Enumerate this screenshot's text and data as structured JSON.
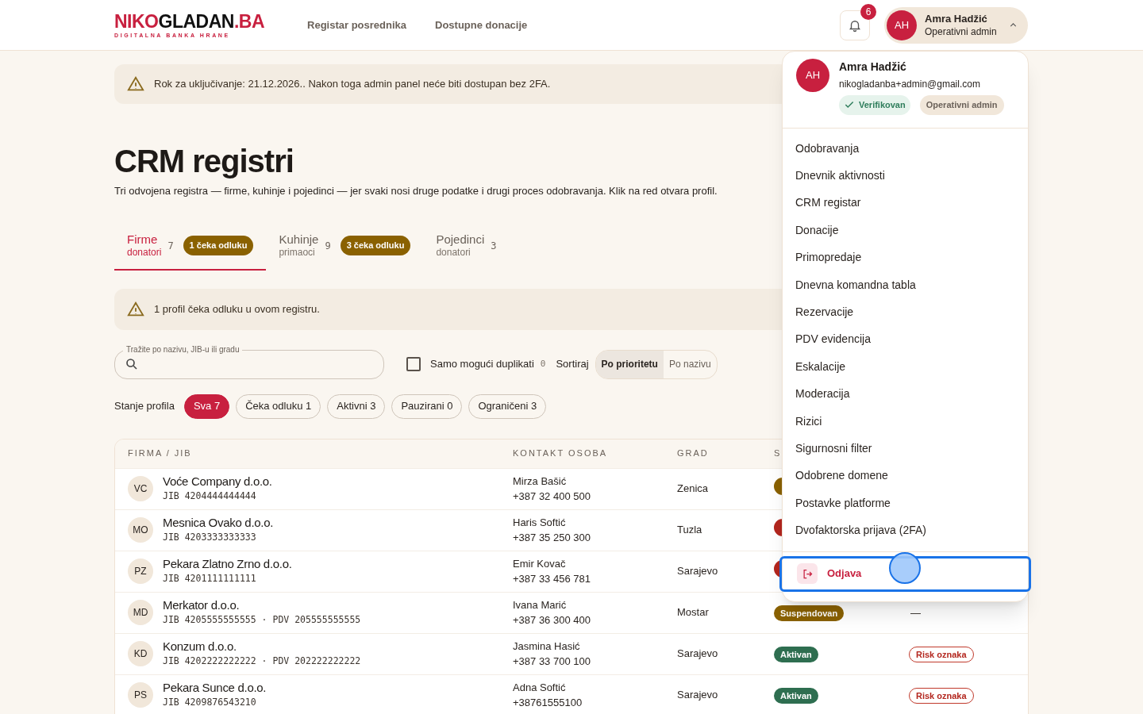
{
  "logo": {
    "parts": [
      {
        "text": "NIKO",
        "accent": true
      },
      {
        "text": "GLADAN",
        "accent": false
      },
      {
        "text": ".BA",
        "accent": true
      }
    ],
    "tagline": "DIGITALNA BANKA HRANE"
  },
  "nav": [
    "Registar posrednika",
    "Dostupne donacije"
  ],
  "notifications": {
    "count": "6"
  },
  "user": {
    "initials": "AH",
    "name": "Amra Hadžić",
    "role": "Operativni admin",
    "expanded": true
  },
  "notice": "Rok za uključivanje: 21.12.2026.. Nakon toga admin panel neće biti dostupan bez 2FA.",
  "title": "CRM registri",
  "subtitle": "Tri odvojena registra — firme, kuhinje i pojedinci — jer svaki nosi druge podatke i drugi proces odobravanja. Klik na red otvara profil.",
  "tabs": [
    {
      "label": "Firme",
      "sub": "donatori",
      "count": "7",
      "badge": "1 čeka odluku",
      "selected": true
    },
    {
      "label": "Kuhinje",
      "sub": "primaoci",
      "count": "9",
      "badge": "3 čeka odluku",
      "selected": false
    },
    {
      "label": "Pojedinci",
      "sub": "donatori",
      "count": "3",
      "selected": false
    }
  ],
  "registry_notice": "1 profil čeka odluku u ovom registru.",
  "search": {
    "label": "Tražite po nazivu, JIB-u ili gradu"
  },
  "duplicates": {
    "label": "Samo mogući duplikati",
    "checked": false,
    "count": "0"
  },
  "sort": {
    "label": "Sortiraj",
    "options": [
      {
        "label": "Po prioritetu",
        "selected": true
      },
      {
        "label": "Po nazivu",
        "selected": false
      }
    ]
  },
  "filters": {
    "label": "Stanje profila",
    "chips": [
      {
        "label": "Sva 7",
        "selected": true
      },
      {
        "label": "Čeka odluku 1",
        "selected": false
      },
      {
        "label": "Aktivni 3",
        "selected": false
      },
      {
        "label": "Pauzirani 0",
        "selected": false
      },
      {
        "label": "Ograničeni 3",
        "selected": false
      }
    ]
  },
  "table": {
    "columns": [
      "FIRMA / JIB",
      "KONTAKT OSOBA",
      "GRAD",
      "S"
    ],
    "rows": [
      {
        "initials": "VC",
        "name": "Voće Company d.o.o.",
        "ids": "JIB 4204444444444",
        "contact": "Mirza Bašić",
        "phone": "+387 32 400 500",
        "city": "Zenica",
        "status": {
          "color": "#8a6100"
        }
      },
      {
        "initials": "MO",
        "name": "Mesnica Ovako d.o.o.",
        "ids": "JIB 4203333333333",
        "contact": "Haris Softić",
        "phone": "+387 35 250 300",
        "city": "Tuzla",
        "status": {
          "color": "#b3261e"
        }
      },
      {
        "initials": "PZ",
        "name": "Pekara Zlatno Zrno d.o.o.",
        "ids": "JIB 4201111111111",
        "contact": "Emir Kovač",
        "phone": "+387 33 456 781",
        "city": "Sarajevo",
        "status": {
          "color": "#b3261e"
        }
      },
      {
        "initials": "MD",
        "name": "Merkator d.o.o.",
        "ids": "JIB 4205555555555 · PDV 205555555555",
        "contact": "Ivana Marić",
        "phone": "+387 36 300 400",
        "city": "Mostar",
        "status": {
          "label": "Suspendovan",
          "color": "#8a6100"
        },
        "risk": {
          "kind": "none",
          "label": "—"
        }
      },
      {
        "initials": "KD",
        "name": "Konzum d.o.o.",
        "ids": "JIB 4202222222222 · PDV 202222222222",
        "contact": "Jasmina Hasić",
        "phone": "+387 33 700 100",
        "city": "Sarajevo",
        "status": {
          "label": "Aktivan",
          "color": "#2e6e50"
        },
        "risk": {
          "kind": "flag",
          "label": "Risk oznaka"
        }
      },
      {
        "initials": "PS",
        "name": "Pekara Sunce d.o.o.",
        "ids": "JIB 4209876543210",
        "contact": "Adna Softić",
        "phone": "+38761555100",
        "city": "Sarajevo",
        "status": {
          "label": "Aktivan",
          "color": "#2e6e50"
        },
        "risk": {
          "kind": "flag",
          "label": "Risk oznaka"
        }
      }
    ]
  },
  "menu": {
    "initials": "AH",
    "name": "Amra Hadžić",
    "email": "nikogladanba+admin@gmail.com",
    "verified": {
      "label": "Verifikovan"
    },
    "role": "Operativni admin",
    "items": [
      "Odobravanja",
      "Dnevnik aktivnosti",
      "CRM registar",
      "Donacije",
      "Primopredaje",
      "Dnevna komandna tabla",
      "Rezervacije",
      "PDV evidencija",
      "Eskalacije",
      "Moderacija",
      "Rizici",
      "Sigurnosni filter",
      "Odobrene domene",
      "Postavke platforme",
      "Dvofaktorska prijava (2FA)"
    ],
    "logout": {
      "label": "Odjava",
      "focused": true
    }
  }
}
